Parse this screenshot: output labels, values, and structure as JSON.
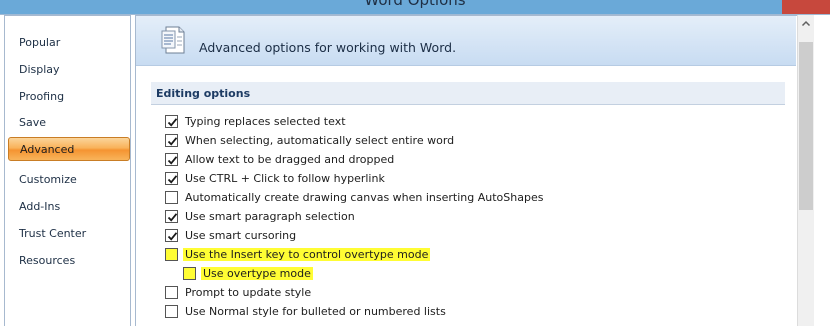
{
  "window": {
    "title": "Word Options"
  },
  "sidebar": {
    "items": [
      {
        "label": "Popular",
        "active": false
      },
      {
        "label": "Display",
        "active": false
      },
      {
        "label": "Proofing",
        "active": false
      },
      {
        "label": "Save",
        "active": false
      },
      {
        "label": "Advanced",
        "active": true
      },
      {
        "label": "Customize",
        "active": false
      },
      {
        "label": "Add-Ins",
        "active": false
      },
      {
        "label": "Trust Center",
        "active": false
      },
      {
        "label": "Resources",
        "active": false
      }
    ]
  },
  "main": {
    "banner_text": "Advanced options for working with Word.",
    "section_title": "Editing options",
    "options": [
      {
        "label": "Typing replaces selected text",
        "checked": true,
        "highlighted": false
      },
      {
        "label": "When selecting, automatically select entire word",
        "checked": true,
        "highlighted": false
      },
      {
        "label": "Allow text to be dragged and dropped",
        "checked": true,
        "highlighted": false
      },
      {
        "label": "Use CTRL + Click to follow hyperlink",
        "checked": true,
        "highlighted": false
      },
      {
        "label": "Automatically create drawing canvas when inserting AutoShapes",
        "checked": false,
        "highlighted": false
      },
      {
        "label": "Use smart paragraph selection",
        "checked": true,
        "highlighted": false
      },
      {
        "label": "Use smart cursoring",
        "checked": true,
        "highlighted": false
      },
      {
        "label": "Use the Insert key to control overtype mode",
        "checked": false,
        "highlighted": true
      },
      {
        "label": "Use overtype mode",
        "checked": false,
        "highlighted": true
      },
      {
        "label": "Prompt to update style",
        "checked": false,
        "highlighted": false
      },
      {
        "label": "Use Normal style for bulleted or numbered lists",
        "checked": false,
        "highlighted": false
      }
    ]
  },
  "colors": {
    "highlight": "#fffd34",
    "active_tab": "#f59431",
    "banner": "#c8dcf2"
  },
  "icons": {
    "banner": "document-options-icon",
    "checkmark": "checkmark-icon",
    "scroll_up": "scroll-up-arrow-icon"
  }
}
